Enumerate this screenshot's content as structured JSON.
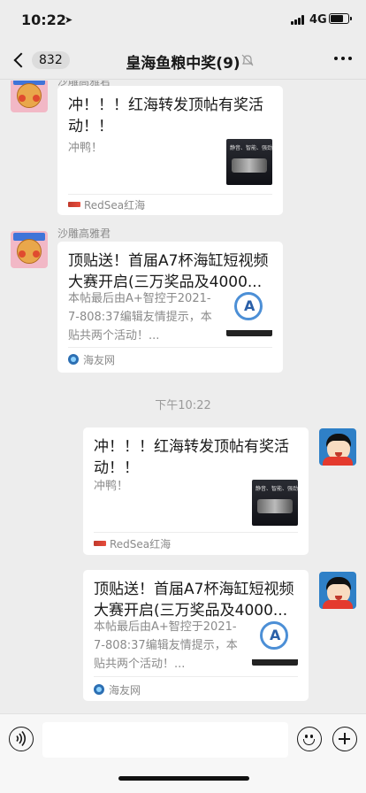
{
  "status_bar": {
    "time": "10:22",
    "network": "4G"
  },
  "nav": {
    "back_count": "832",
    "title": "皇海鱼粮中奖(9)"
  },
  "messages": [
    {
      "side": "left",
      "sender": "沙雕高雅君",
      "title": "冲！！！红海转发顶帖有奖活动！！",
      "desc": "冲鸭！",
      "thumb_caption": "静音、智能、强劲",
      "source": "RedSea红海"
    },
    {
      "side": "left",
      "sender": "沙雕高雅君",
      "title": "顶贴送！首届A7杯海缸短视频大赛开启(三万奖品及4000...",
      "desc": "本帖最后由A+智控于2021-7-808:37编辑友情提示，本贴共两个活动！...",
      "source": "海友网"
    },
    {
      "type": "time",
      "text": "下午10:22"
    },
    {
      "side": "right",
      "title": "冲！！！红海转发顶帖有奖活动！！",
      "desc": "冲鸭！",
      "thumb_caption": "静音、智能、强劲",
      "source": "RedSea红海"
    },
    {
      "side": "right",
      "title": "顶贴送！首届A7杯海缸短视频大赛开启(三万奖品及4000...",
      "desc": "本帖最后由A+智控于2021-7-808:37编辑友情提示，本贴共两个活动！...",
      "source": "海友网"
    }
  ],
  "icons": {
    "voice": "voice-icon",
    "emoji": "emoji-icon",
    "plus": "plus-icon",
    "mute": "mute-icon",
    "more": "more-icon"
  }
}
